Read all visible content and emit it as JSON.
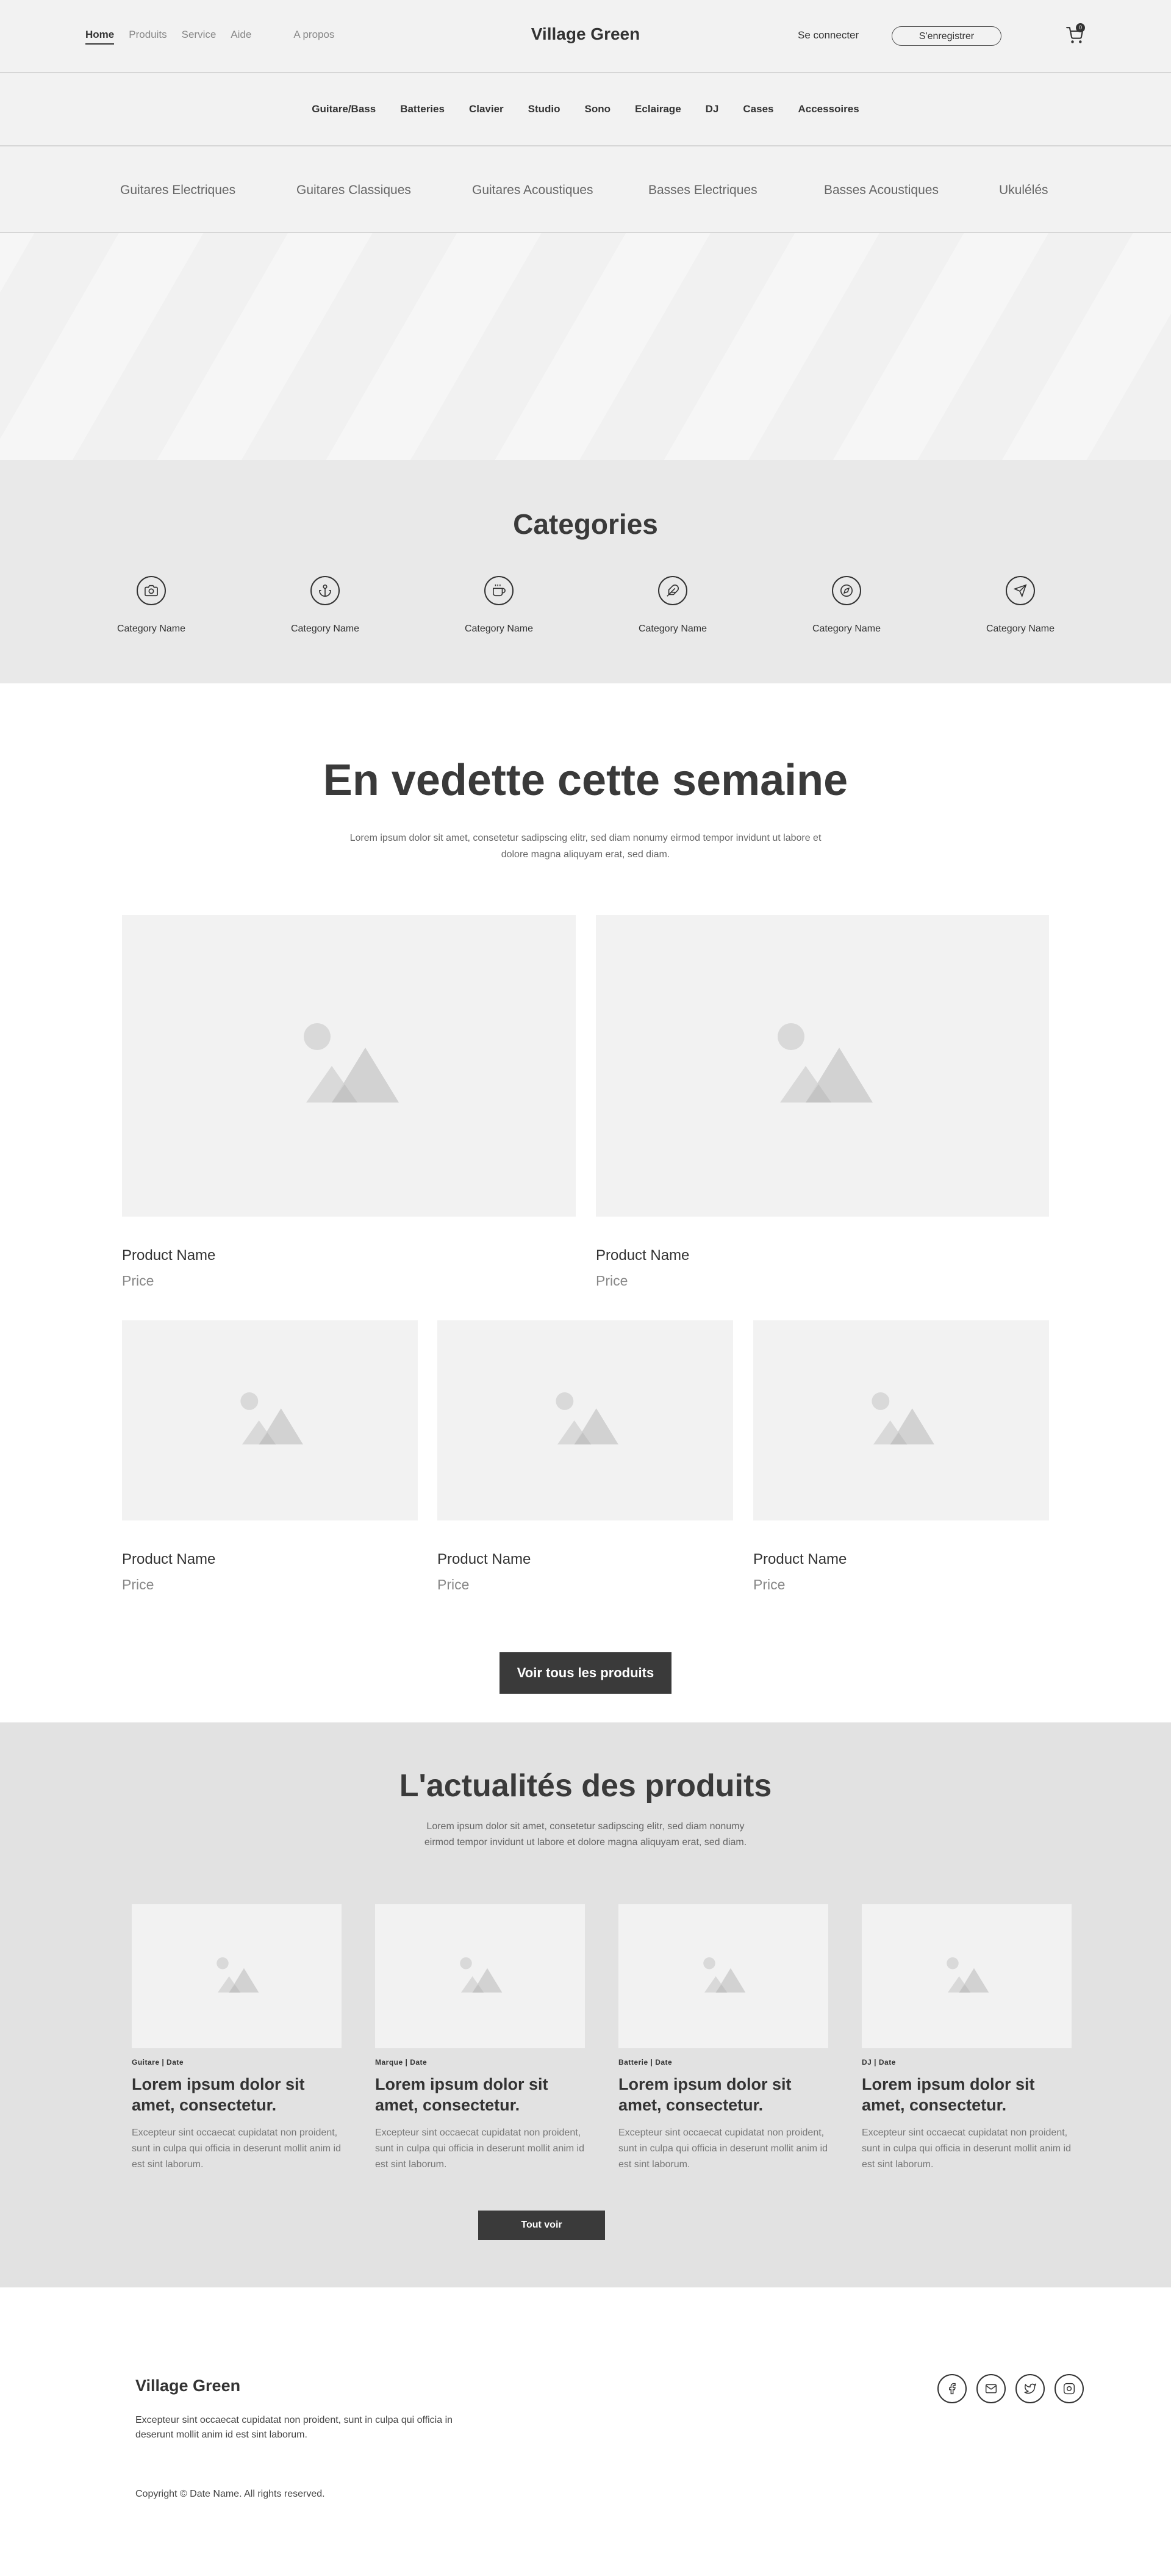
{
  "header": {
    "nav": [
      {
        "label": "Home",
        "active": true
      },
      {
        "label": "Produits",
        "active": false
      },
      {
        "label": "Service",
        "active": false
      },
      {
        "label": "Aide",
        "active": false
      },
      {
        "label": "A propos",
        "active": false
      }
    ],
    "brand": "Village Green",
    "login_label": "Se connecter",
    "register_label": "S'enregistrer",
    "cart_count": "0"
  },
  "category_bar": [
    "Guitare/Bass",
    "Batteries",
    "Clavier",
    "Studio",
    "Sono",
    "Eclairage",
    "DJ",
    "Cases",
    "Accessoires"
  ],
  "sub_bar": [
    "Guitares Electriques",
    "Guitares Classiques",
    "Guitares Acoustiques",
    "Basses Electriques",
    "Basses Acoustiques",
    "Ukulélés"
  ],
  "categories": {
    "title": "Categories",
    "items": [
      {
        "icon": "camera-icon",
        "label": "Category Name"
      },
      {
        "icon": "anchor-icon",
        "label": "Category Name"
      },
      {
        "icon": "coffee-icon",
        "label": "Category Name"
      },
      {
        "icon": "feather-icon",
        "label": "Category Name"
      },
      {
        "icon": "compass-icon",
        "label": "Category Name"
      },
      {
        "icon": "send-icon",
        "label": "Category Name"
      }
    ]
  },
  "featured": {
    "title": "En vedette cette semaine",
    "lead": "Lorem ipsum dolor sit amet, consetetur sadipscing elitr, sed diam nonumy eirmod tempor invidunt ut labore et dolore magna aliquyam erat, sed diam.",
    "products": [
      {
        "name": "Product Name",
        "price": "Price"
      },
      {
        "name": "Product Name",
        "price": "Price"
      },
      {
        "name": "Product Name",
        "price": "Price"
      },
      {
        "name": "Product Name",
        "price": "Price"
      },
      {
        "name": "Product Name",
        "price": "Price"
      }
    ],
    "button_label": "Voir tous les produits"
  },
  "news": {
    "title": "L'actualités des produits",
    "lead": "Lorem ipsum dolor sit amet, consetetur sadipscing elitr, sed diam nonumy eirmod tempor invidunt ut labore et dolore magna aliquyam erat, sed diam.",
    "cards": [
      {
        "meta": "Guitare  |  Date",
        "title": "Lorem ipsum dolor sit amet, consectetur.",
        "text": "Excepteur sint occaecat cupidatat non proident, sunt in culpa qui officia in deserunt mollit anim id est sint laborum."
      },
      {
        "meta": "Marque  |  Date",
        "title": "Lorem ipsum dolor sit amet, consectetur.",
        "text": "Excepteur sint occaecat cupidatat non proident, sunt in culpa qui officia in deserunt mollit anim id est sint laborum."
      },
      {
        "meta": "Batterie  |  Date",
        "title": "Lorem ipsum dolor sit amet, consectetur.",
        "text": "Excepteur sint occaecat cupidatat non proident, sunt in culpa qui officia in deserunt mollit anim id est sint laborum."
      },
      {
        "meta": "DJ  |  Date",
        "title": "Lorem ipsum dolor sit amet, consectetur.",
        "text": "Excepteur sint occaecat cupidatat non proident, sunt in culpa qui officia in deserunt mollit anim id est sint laborum."
      }
    ],
    "button_label": "Tout voir"
  },
  "footer": {
    "brand": "Village Green",
    "text": "Excepteur sint occaecat cupidatat non proident, sunt in culpa qui officia in deserunt mollit anim id est sint laborum.",
    "copyright": "Copyright © Date Name. All rights reserved.",
    "social": [
      "facebook-icon",
      "mail-icon",
      "twitter-icon",
      "instagram-icon"
    ]
  }
}
